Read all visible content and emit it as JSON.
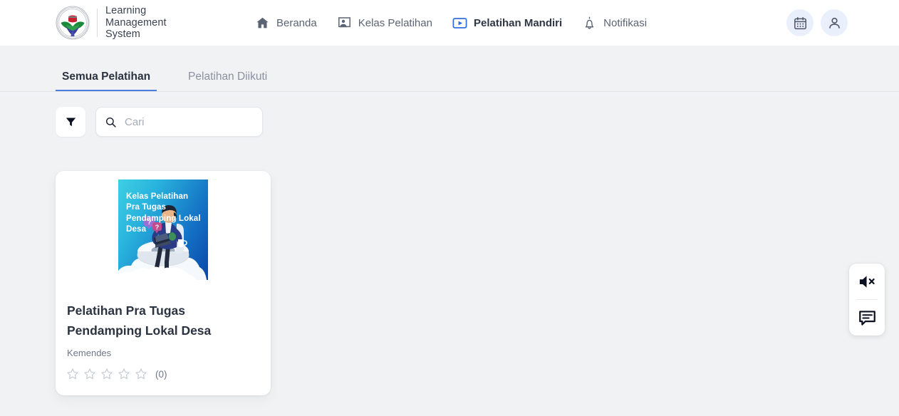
{
  "header": {
    "brand": {
      "logo_icon": "kemendes-emblem-logo",
      "line1": "Learning",
      "line2": "Management",
      "line3": "System"
    },
    "nav": [
      {
        "label": "Beranda",
        "icon": "home-icon",
        "active": false
      },
      {
        "label": "Kelas Pelatihan",
        "icon": "presentation-person-icon",
        "active": false
      },
      {
        "label": "Pelatihan Mandiri",
        "icon": "video-play-icon",
        "active": true
      },
      {
        "label": "Notifikasi",
        "icon": "bell-icon",
        "active": false
      }
    ],
    "actions": [
      {
        "name": "calendar-button",
        "icon": "calendar-icon"
      },
      {
        "name": "profile-button",
        "icon": "person-icon"
      }
    ]
  },
  "tabs": [
    {
      "label": "Semua Pelatihan",
      "active": true
    },
    {
      "label": "Pelatihan Diikuti",
      "active": false
    }
  ],
  "toolbar": {
    "filter_icon": "filter-funnel-icon",
    "search_icon": "search-icon",
    "search_placeholder": "Cari",
    "search_value": ""
  },
  "courses": [
    {
      "thumbnail_title": "Kelas Pelatihan Pra Tugas Pendamping Lokal Desa",
      "title": "Pelatihan Pra Tugas Pendamping Lokal Desa",
      "publisher": "Kemendes",
      "rating": 0,
      "rating_count_label": "(0)",
      "stars_total": 5
    }
  ],
  "float_widget": {
    "buttons": [
      {
        "name": "mute-sound-button",
        "icon": "speaker-muted-icon"
      },
      {
        "name": "chat-button",
        "icon": "chat-bubble-icon"
      }
    ]
  },
  "colors": {
    "page_bg": "#f1f2f4",
    "header_bg": "#ffffff",
    "accent_blue": "#2f6fe0",
    "tab_underline": "#4a7ddc",
    "text_dark": "#2b3240",
    "text_muted": "#70778a",
    "thumb_gradient_from": "#3ed0e4",
    "thumb_gradient_to": "#0a47a8"
  }
}
